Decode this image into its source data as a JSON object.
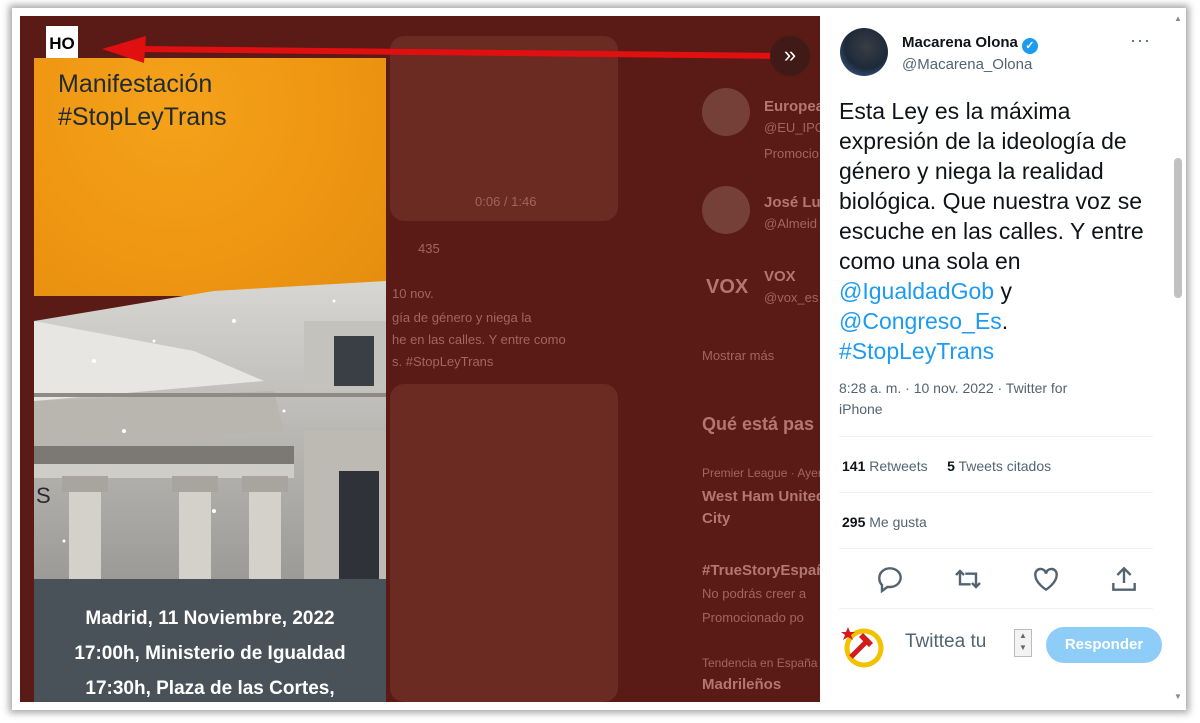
{
  "media": {
    "header_label": "HO",
    "title_line1": "Manifestación",
    "title_line2": "#StopLeyTrans",
    "details": [
      "Madrid, 11 Noviembre, 2022",
      "17:00h, Ministerio de Igualdad",
      "17:30h, Plaza de las Cortes,"
    ],
    "letter_on_building": "S",
    "expand_icon": "»"
  },
  "background": {
    "video_time": "0:06 / 1:46",
    "likes_count": "435",
    "date": "10 nov.",
    "snippet1": "gía de género y niega la",
    "snippet2": "he en las calles. Y entre como",
    "snippet3": "s. #StopLeyTrans",
    "who1_name": "Europea",
    "who1_handle": "@EU_IPO",
    "who1_promo": "Promocio",
    "who2_name": "José Luis",
    "who2_handle": "@Almeid",
    "who3_name": "VOX",
    "who3_handle": "@vox_es",
    "show_more": "Mostrar más",
    "trends_title": "Qué está pas",
    "trend1_meta": "Premier League · Ayer",
    "trend1_title1": "West Ham United",
    "trend1_title2": "City",
    "trend2_tag": "#TrueStoryEspaña",
    "trend2_desc": "No podrás creer a",
    "trend2_promo": "Promocionado po",
    "trend3_meta": "Tendencia en España",
    "trend3_title": "Madrileños"
  },
  "tweet": {
    "author_name": "Macarena Olona",
    "author_handle": "@Macarena_Olona",
    "more": "···",
    "text_plain": "Esta Ley es la máxima expresión de la ideología de género y niega la realidad biológica. Que nuestra voz se escuche en las calles. Y entre como una sola en",
    "mention1": "@IgualdadGob",
    "connector": " y",
    "mention2": "@Congreso_Es",
    "period": ".",
    "hashtag": "#StopLeyTrans",
    "timestamp_line1": "8:28 a. m. · 10 nov. 2022 · Twitter for",
    "timestamp_line2": "iPhone",
    "retweets_count": "141",
    "retweets_label": "Retweets",
    "quotes_count": "5",
    "quotes_label": "Tweets citados",
    "likes_count": "295",
    "likes_label": "Me gusta"
  },
  "reply": {
    "placeholder": "Twittea tu",
    "button_label": "Responder"
  },
  "colors": {
    "accent": "#1d9bf0",
    "reply_button": "#8ecdf7",
    "overlay": "#5a1a15",
    "poster_orange": "#ef9612",
    "arrow_red": "#e01010"
  }
}
